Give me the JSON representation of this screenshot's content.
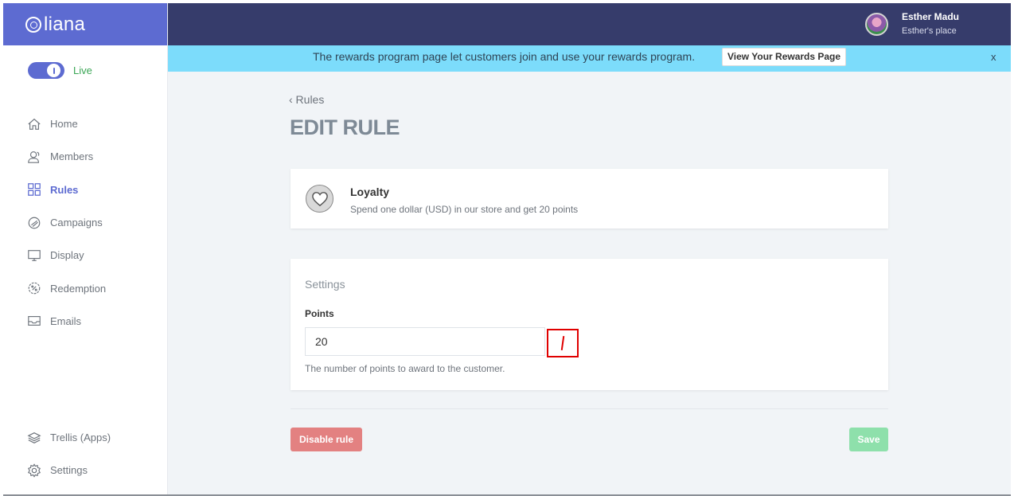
{
  "brand": {
    "name": "liana"
  },
  "sidebar": {
    "live_label": "Live",
    "items": [
      {
        "label": "Home",
        "icon": "home-icon"
      },
      {
        "label": "Members",
        "icon": "members-icon"
      },
      {
        "label": "Rules",
        "icon": "rules-grid-icon",
        "active": true
      },
      {
        "label": "Campaigns",
        "icon": "campaigns-icon"
      },
      {
        "label": "Display",
        "icon": "monitor-icon"
      },
      {
        "label": "Redemption",
        "icon": "redemption-icon"
      },
      {
        "label": "Emails",
        "icon": "inbox-icon"
      }
    ],
    "bottom_items": [
      {
        "label": "Trellis (Apps)",
        "icon": "layers-icon"
      },
      {
        "label": "Settings",
        "icon": "gear-icon"
      }
    ]
  },
  "header": {
    "user_name": "Esther Madu",
    "user_place": "Esther's place"
  },
  "banner": {
    "text": "The rewards program page let customers join and use your rewards program.",
    "button_label": "View Your Rewards Page",
    "close_label": "x"
  },
  "main": {
    "breadcrumb": "‹ Rules",
    "title": "EDIT RULE",
    "rule": {
      "name": "Loyalty",
      "description": "Spend one dollar (USD) in our store and get 20 points",
      "icon": "heart-icon"
    },
    "settings": {
      "heading": "Settings",
      "points_label": "Points",
      "points_value": "20",
      "points_help": "The number of points to award to the customer."
    },
    "disable_button": "Disable rule",
    "save_button": "Save"
  },
  "colors": {
    "brand": "#5d6bd1",
    "header": "#363c6b",
    "banner": "#7cdcfb",
    "live": "#3aa655",
    "disable": "#e38181",
    "save": "#8ee0ab"
  }
}
